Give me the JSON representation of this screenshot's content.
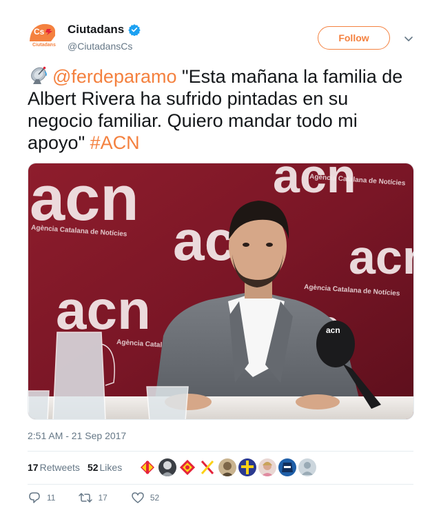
{
  "account": {
    "display_name": "Ciutadans",
    "handle": "@CiutadansCs",
    "follow_label": "Follow",
    "logo_text": "Cs",
    "logo_subtext": "Ciutadans",
    "verified": true
  },
  "tweet": {
    "emoji": "satellite-antenna",
    "mention": "@ferdeparamo",
    "text": " \"Esta mañana la familia de Albert Rivera ha sufrido pintadas en su negocio familiar. Quiero mandar todo mi apoyo\" ",
    "hashtag": "#ACN",
    "timestamp": "2:51 AM - 21 Sep 2017"
  },
  "photo": {
    "backdrop_logo_text": "acn",
    "backdrop_caption": "Agència Catalana de Notícies",
    "mic_logo_text": "acn"
  },
  "stats": {
    "retweets_count": "17",
    "retweets_label": "Retweets",
    "likes_count": "52",
    "likes_label": "Likes"
  },
  "actions": {
    "reply_count": "11",
    "retweet_count": "17",
    "like_count": "52"
  },
  "colors": {
    "accent": "#f4813f",
    "verified": "#1da1f2",
    "muted": "#657786",
    "text": "#14171a",
    "divider": "#e6ecf0"
  }
}
